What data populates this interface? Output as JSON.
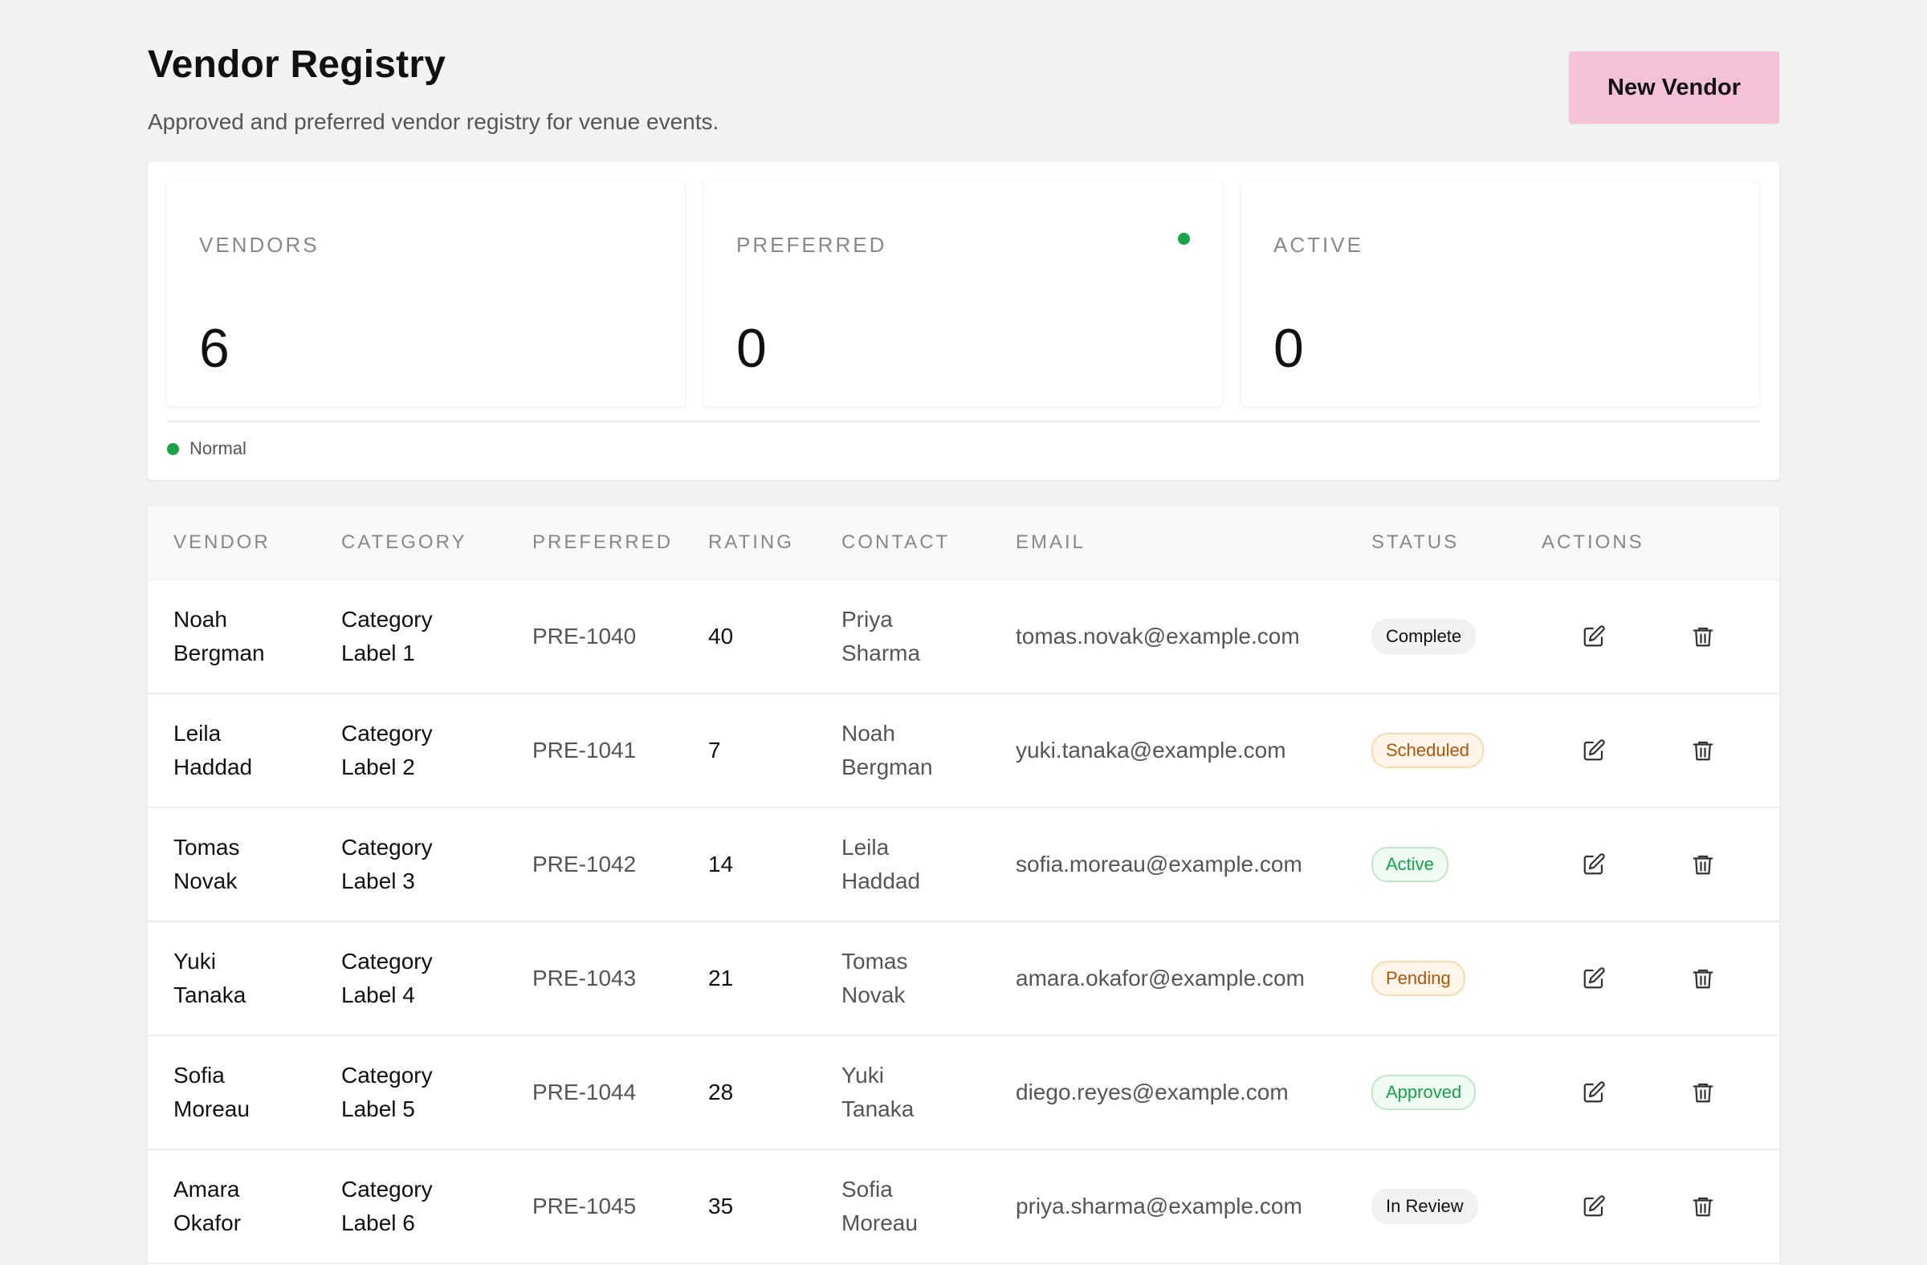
{
  "header": {
    "title": "Vendor Registry",
    "subtitle": "Approved and preferred vendor registry for venue events.",
    "new_button_label": "New Vendor"
  },
  "stats": [
    {
      "label": "VENDORS",
      "value": "6",
      "indicator": false
    },
    {
      "label": "PREFERRED",
      "value": "0",
      "indicator": true,
      "indicator_color": "#16a34a"
    },
    {
      "label": "ACTIVE",
      "value": "0",
      "indicator": false
    }
  ],
  "legend": {
    "label": "Normal",
    "color": "#16a34a"
  },
  "table": {
    "columns": [
      "VENDOR",
      "CATEGORY",
      "PREFERRED",
      "RATING",
      "CONTACT",
      "EMAIL",
      "STATUS",
      "ACTIONS"
    ],
    "rows": [
      {
        "vendor_first": "Noah",
        "vendor_last": "Bergman",
        "category_1": "Category",
        "category_2": "Label 1",
        "preferred": "PRE-1040",
        "rating": "40",
        "contact_first": "Priya",
        "contact_last": "Sharma",
        "email": "tomas.novak@example.com",
        "status": "Complete"
      },
      {
        "vendor_first": "Leila",
        "vendor_last": "Haddad",
        "category_1": "Category",
        "category_2": "Label 2",
        "preferred": "PRE-1041",
        "rating": "7",
        "contact_first": "Noah",
        "contact_last": "Bergman",
        "email": "yuki.tanaka@example.com",
        "status": "Scheduled"
      },
      {
        "vendor_first": "Tomas",
        "vendor_last": "Novak",
        "category_1": "Category",
        "category_2": "Label 3",
        "preferred": "PRE-1042",
        "rating": "14",
        "contact_first": "Leila",
        "contact_last": "Haddad",
        "email": "sofia.moreau@example.com",
        "status": "Active"
      },
      {
        "vendor_first": "Yuki",
        "vendor_last": "Tanaka",
        "category_1": "Category",
        "category_2": "Label 4",
        "preferred": "PRE-1043",
        "rating": "21",
        "contact_first": "Tomas",
        "contact_last": "Novak",
        "email": "amara.okafor@example.com",
        "status": "Pending"
      },
      {
        "vendor_first": "Sofia",
        "vendor_last": "Moreau",
        "category_1": "Category",
        "category_2": "Label 5",
        "preferred": "PRE-1044",
        "rating": "28",
        "contact_first": "Yuki",
        "contact_last": "Tanaka",
        "email": "diego.reyes@example.com",
        "status": "Approved"
      },
      {
        "vendor_first": "Amara",
        "vendor_last": "Okafor",
        "category_1": "Category",
        "category_2": "Label 6",
        "preferred": "PRE-1045",
        "rating": "35",
        "contact_first": "Sofia",
        "contact_last": "Moreau",
        "email": "priya.sharma@example.com",
        "status": "In Review"
      }
    ],
    "action_icons": [
      "edit-icon",
      "trash-icon"
    ]
  },
  "status_styles": {
    "Complete": {
      "bg": "#f1f1f1",
      "fg": "#111111",
      "border": "#f1f1f1"
    },
    "Scheduled": {
      "bg": "#fff5e8",
      "fg": "#b45309",
      "border": "#fbd9a8"
    },
    "Active": {
      "bg": "#effaf2",
      "fg": "#16a34a",
      "border": "#bfe6c9"
    },
    "Pending": {
      "bg": "#fff5e8",
      "fg": "#b45309",
      "border": "#fbd9a8"
    },
    "Approved": {
      "bg": "#effaf2",
      "fg": "#16a34a",
      "border": "#bfe6c9"
    },
    "In Review": {
      "bg": "#f1f1f1",
      "fg": "#111111",
      "border": "#f1f1f1"
    }
  }
}
